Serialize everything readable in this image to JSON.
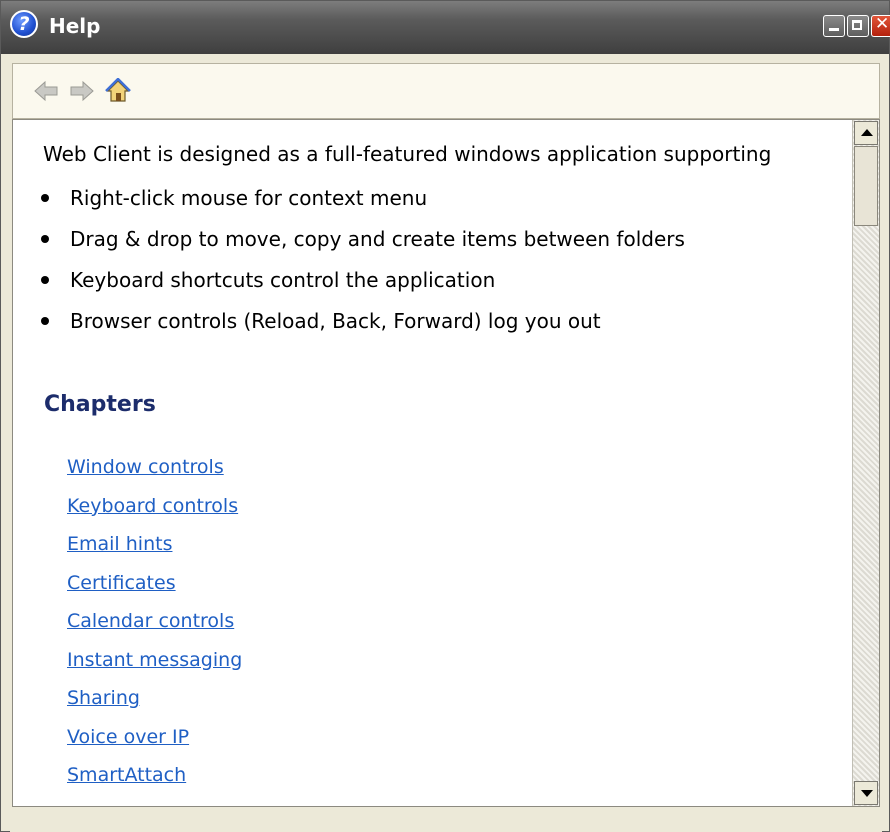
{
  "window": {
    "title": "Help",
    "icon": "help-icon",
    "controls": [
      "minimize-icon",
      "maximize-icon",
      "close-icon"
    ]
  },
  "toolbar": {
    "buttons": [
      {
        "name": "back",
        "icon": "back-arrow-icon"
      },
      {
        "name": "forward",
        "icon": "forward-arrow-icon"
      },
      {
        "name": "home",
        "icon": "home-icon"
      }
    ]
  },
  "content": {
    "intro": "Web Client is designed as a full-featured windows application supporting",
    "bullets": [
      "Right-click mouse for context menu",
      "Drag & drop to move, copy and create items between folders",
      "Keyboard shortcuts control the application",
      "Browser controls (Reload, Back, Forward) log you out"
    ],
    "chapters_heading": "Chapters",
    "chapters": [
      "Window controls",
      "Keyboard controls",
      "Email hints",
      "Certificates",
      "Calendar controls",
      "Instant messaging",
      "Sharing",
      "Voice over IP",
      "SmartAttach"
    ]
  },
  "colors": {
    "titlebar": "#4a4a4a",
    "link": "#1f5fc4",
    "heading": "#1c2c6b",
    "frame": "#ece9d8"
  }
}
